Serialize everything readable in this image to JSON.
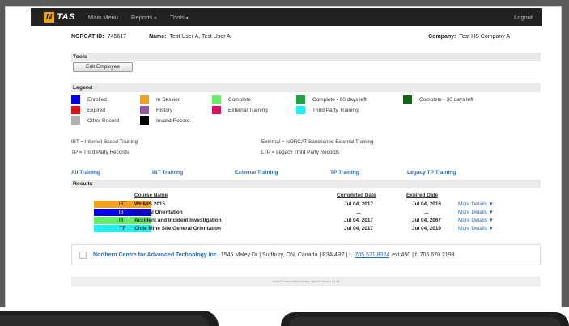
{
  "navbar": {
    "logo_n": "N",
    "logo_tas": "TAS",
    "items": [
      "Main Menu",
      "Reports",
      "Tools"
    ],
    "logout": "Logout"
  },
  "header": {
    "norcat_id_label": "NORCAT ID:",
    "norcat_id": "745617",
    "name_label": "Name:",
    "name": "Test User A, Test User A",
    "company_label": "Company:",
    "company": "Test HS Company A"
  },
  "tools": {
    "title": "Tools",
    "edit_button": "Edit Employee"
  },
  "legend": {
    "title": "Legend",
    "items": [
      {
        "label": "Enrolled",
        "color": "#0000ee"
      },
      {
        "label": "In Session",
        "color": "#f4a11c"
      },
      {
        "label": "Complete",
        "color": "#66ee66"
      },
      {
        "label": "Complete - 60 days left",
        "color": "#22a244"
      },
      {
        "label": "Complete - 30 days left",
        "color": "#116611"
      },
      {
        "label": "Expired",
        "color": "#dd1111"
      },
      {
        "label": "History",
        "color": "#9955aa"
      },
      {
        "label": "External Training",
        "color": "#e0115a"
      },
      {
        "label": "Third Party Training",
        "color": "#22eeee"
      },
      {
        "label": "Other Record",
        "color": "#b0b0b0"
      },
      {
        "label": "Invalid Record",
        "color": "#000000"
      }
    ]
  },
  "abbreviations": {
    "ibt": "IBT = Internet Based Training",
    "tp": "TP = Third Party Records",
    "external": "External = NORCAT Sanctioned External Training",
    "ltp": "LTP = Legacy Third Party Records"
  },
  "tabs": [
    "All Training",
    "IBT Training",
    "External Training",
    "TP Training",
    "Legacy TP Training"
  ],
  "results": {
    "title": "Results",
    "columns": {
      "course_name": "Course Name",
      "completed_date": "Completed Date",
      "expired_date": "Expired Date"
    },
    "rows": [
      {
        "type": "IBT",
        "color": "#f4a11c",
        "text_color": "#111111",
        "course": "WHMIS 2015",
        "completed": "Jul 04, 2017",
        "expired": "Jul 04, 2018",
        "more": "More Details ▼"
      },
      {
        "type": "IBT",
        "color": "#0000ee",
        "text_color": "#ffffff",
        "course": "General Orientation",
        "completed": "...",
        "expired": "...",
        "more": "More Details ▼"
      },
      {
        "type": "IBT",
        "color": "#66ee66",
        "text_color": "#111111",
        "course": "Accident and Incident Investigation",
        "completed": "Jul 04, 2017",
        "expired": "Jul 04, 2067",
        "more": "More Details ▼"
      },
      {
        "type": "TP",
        "color": "#22eeee",
        "text_color": "#111111",
        "course": "Chile Mine Site General Orientation",
        "completed": "Jul 04, 2017",
        "expired": "Jul 04, 2019",
        "more": "More Details ▼"
      }
    ]
  },
  "footer": {
    "org": "Northern Centre for Advanced Technology Inc.",
    "address": "1545 Maley Dr | Sudbury, ON, Canada | P3A 4R7 | t.",
    "phone": "705.521.8324",
    "rest": "ext.450 | f. 705.670.2193",
    "version": "Norcat Training Administration System Version 2.1.46"
  }
}
